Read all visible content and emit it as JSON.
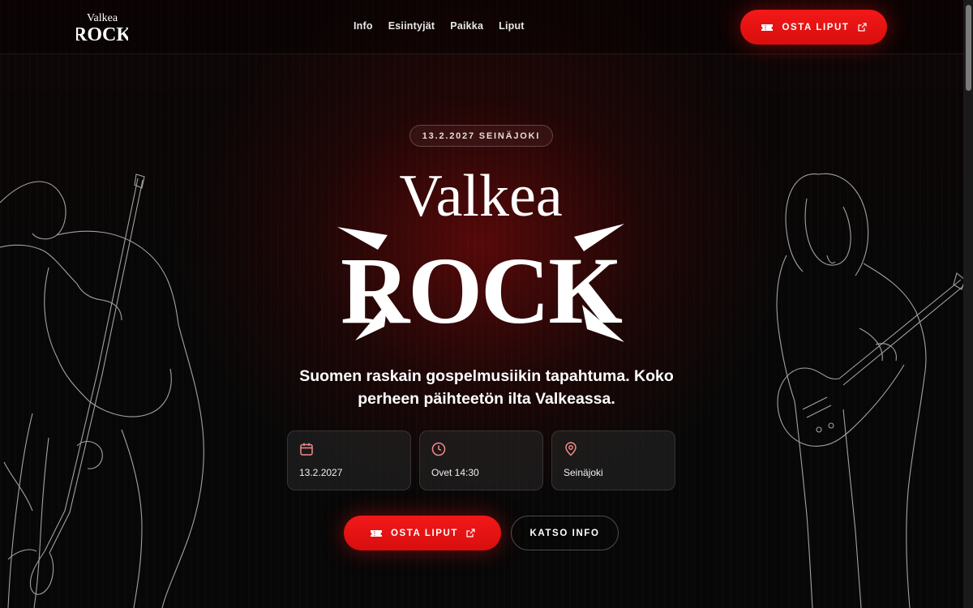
{
  "header": {
    "logo": {
      "line1": "Valkea",
      "line2": "ROCK"
    },
    "nav": [
      "Info",
      "Esiintyjät",
      "Paikka",
      "Liput"
    ],
    "cta_label": "OSTA LIPUT"
  },
  "hero": {
    "date_pill": "13.2.2027 SEINÄJOKI",
    "logo": {
      "line1": "Valkea",
      "line2": "ROCK"
    },
    "tagline": "Suomen raskain gospelmusiikin tapahtuma. Koko perheen päihteetön ilta Valkeassa.",
    "cards": [
      {
        "icon": "calendar-icon",
        "text": "13.2.2027"
      },
      {
        "icon": "clock-icon",
        "text": "Ovet 14:30"
      },
      {
        "icon": "map-pin-icon",
        "text": "Seinäjoki"
      }
    ],
    "primary_label": "OSTA LIPUT",
    "secondary_label": "KATSO INFO"
  },
  "colors": {
    "accent": "#e81414",
    "icon_accent": "#f08a8a",
    "background": "#070707"
  }
}
